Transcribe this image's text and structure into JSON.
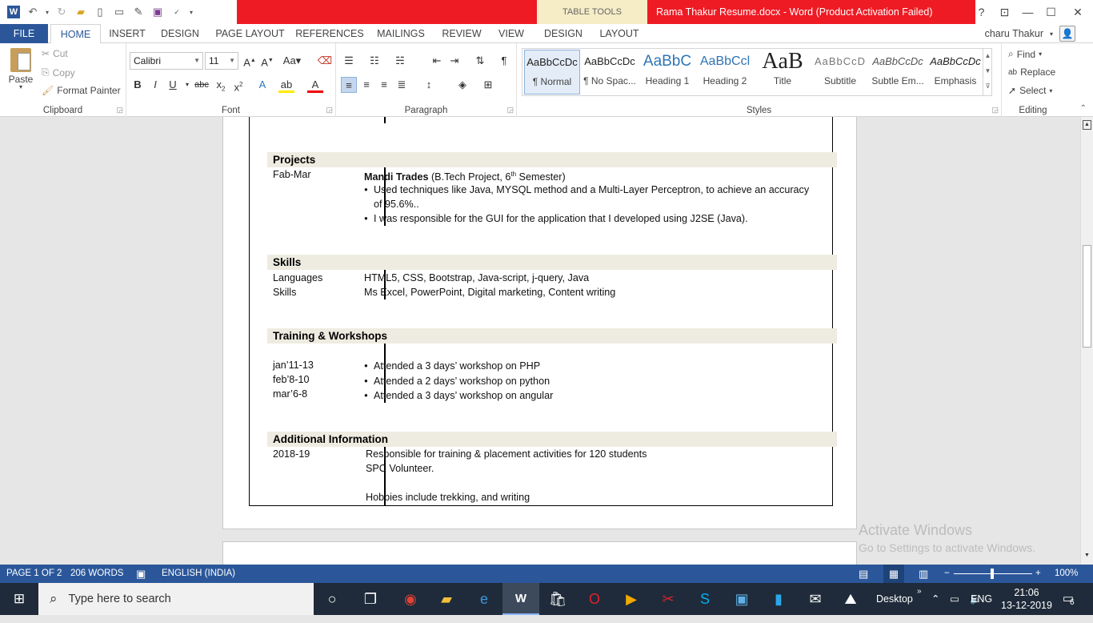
{
  "titlebar": {
    "table_tools": "TABLE TOOLS",
    "doc_title": "Rama Thakur Resume.docx  -  Word (Product Activation Failed)",
    "help": "?",
    "restore_ribbon": "⊡",
    "minimize": "—",
    "maximize": "☐",
    "close": "✕"
  },
  "tabs": [
    "FILE",
    "HOME",
    "INSERT",
    "DESIGN",
    "PAGE LAYOUT",
    "REFERENCES",
    "MAILINGS",
    "REVIEW",
    "VIEW",
    "DESIGN",
    "LAYOUT"
  ],
  "user": {
    "name": "charu Thakur"
  },
  "clipboard": {
    "paste": "Paste",
    "cut": "Cut",
    "copy": "Copy",
    "format_painter": "Format Painter",
    "label": "Clipboard"
  },
  "font": {
    "family": "Calibri",
    "size": "11",
    "label": "Font"
  },
  "paragraph": {
    "label": "Paragraph"
  },
  "styles": {
    "items": [
      {
        "sample": "AaBbCcDc",
        "name": "¶ Normal"
      },
      {
        "sample": "AaBbCcDc",
        "name": "¶ No Spac..."
      },
      {
        "sample": "AaBbC",
        "name": "Heading 1"
      },
      {
        "sample": "AaBbCcl",
        "name": "Heading 2"
      },
      {
        "sample": "AaB",
        "name": "Title"
      },
      {
        "sample": "AaBbCcD",
        "name": "Subtitle"
      },
      {
        "sample": "AaBbCcDc",
        "name": "Subtle Em..."
      },
      {
        "sample": "AaBbCcDc",
        "name": "Emphasis"
      }
    ],
    "label": "Styles"
  },
  "editing": {
    "find": "Find",
    "replace": "Replace",
    "select": "Select",
    "label": "Editing"
  },
  "document": {
    "projects": {
      "heading": "Projects",
      "date": "Fab-Mar",
      "title_bold": "Mandi Trades",
      "title_rest": " (B.Tech Project, 6",
      "title_sup": "th",
      "title_end": " Semester)",
      "bullet1_line1": "Used techniques like Java, MYSQL method and a Multi-Layer Perceptron, to achieve an accuracy",
      "bullet1_line2": "of 95.6%..",
      "bullet2": "I was responsible for the GUI for the application that I developed using J2SE (Java)."
    },
    "skills": {
      "heading": "Skills",
      "row1_label": "Languages",
      "row1_value": " HTML5, CSS, Bootstrap, Java-script, j-query, Java",
      "row2_label": "Skills",
      "row2_value": "Ms Excel, PowerPoint, Digital marketing, Content writing"
    },
    "training": {
      "heading": "Training & Workshops",
      "items": [
        {
          "date": "jan’11-13",
          "text": "Attended a 3 days’ workshop on PHP"
        },
        {
          "date": "feb’8-10",
          "text": "Attended a 2 days’ workshop on python"
        },
        {
          "date": "mar’6-8",
          "text": "Attended a 3 days’ workshop on angular"
        }
      ]
    },
    "additional": {
      "heading": "Additional Information",
      "date": "2018-19",
      "line1": "Responsible for training & placement activities for 120 students",
      "line2": "SPC Volunteer.",
      "line3": "Hobbies include trekking, and writing"
    }
  },
  "watermark": {
    "line1": "Activate Windows",
    "line2": "Go to Settings to activate Windows."
  },
  "status": {
    "page": "PAGE 1 OF 2",
    "words": "206 WORDS",
    "language": "ENGLISH (INDIA)",
    "zoom": "100%"
  },
  "taskbar": {
    "search_placeholder": "Type here to search",
    "desktop": "Desktop",
    "lang": "ENG",
    "time": "21:06",
    "date": "13-12-2019",
    "notifications": "6"
  }
}
